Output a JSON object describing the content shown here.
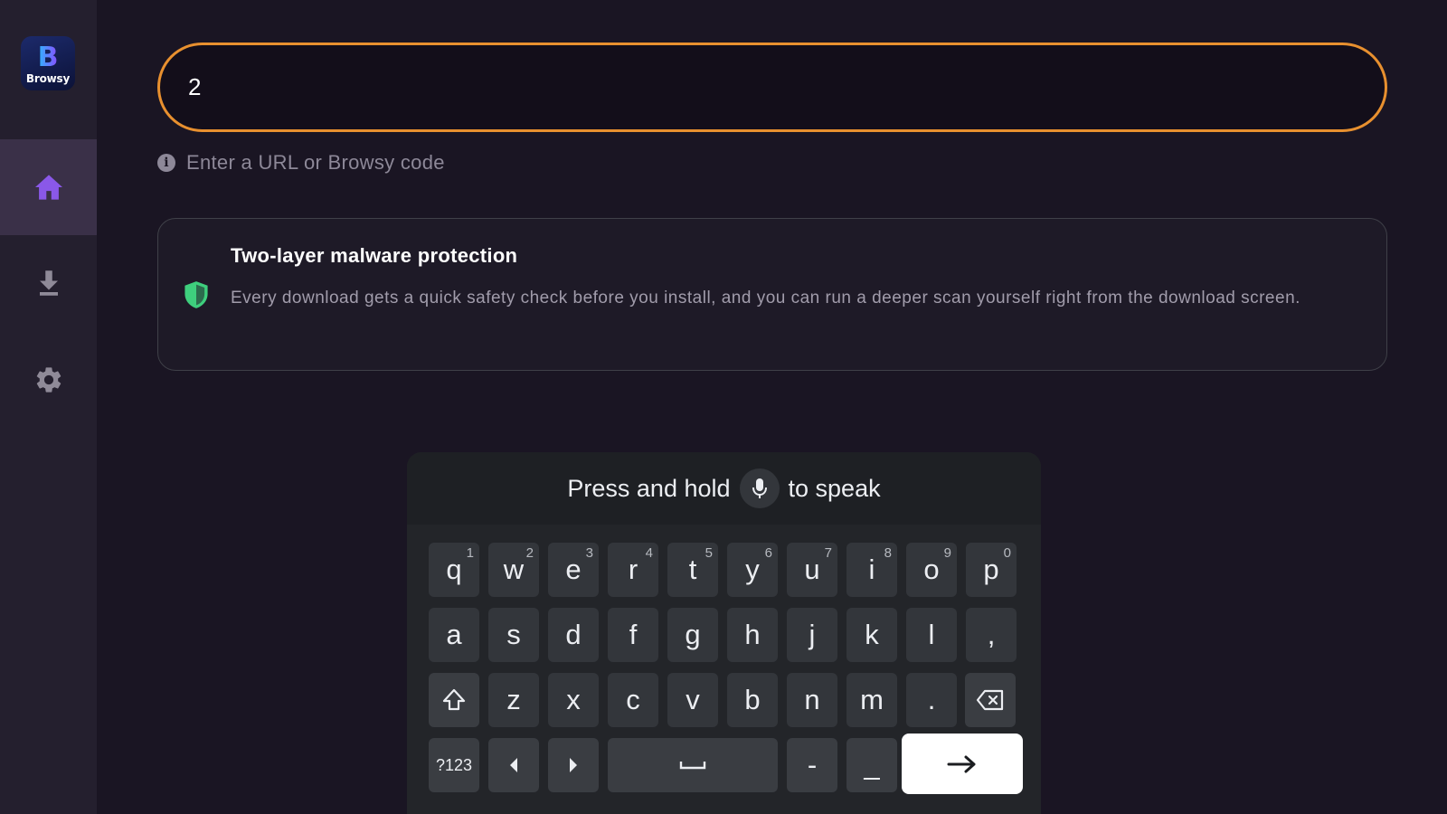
{
  "app": {
    "name": "Browsy"
  },
  "sidebar": {
    "logo_text": "Browsy",
    "logo_letter": "B",
    "items": [
      {
        "name": "home",
        "icon": "home-icon",
        "active": true
      },
      {
        "name": "downloads",
        "icon": "download-icon",
        "active": false
      },
      {
        "name": "settings",
        "icon": "gear-icon",
        "active": false
      }
    ]
  },
  "search": {
    "value": "2",
    "hint": "Enter a URL or Browsy code",
    "accent_color": "#e8902f"
  },
  "card": {
    "title": "Two-layer malware protection",
    "body": "Every download gets a quick safety check before you install, and you can run a deeper scan yourself right from the download screen.",
    "icon": "shield-icon",
    "icon_color": "#3ecf7d"
  },
  "keyboard": {
    "voice_prefix": "Press and hold",
    "voice_suffix": "to speak",
    "row1": [
      {
        "k": "q",
        "s": "1"
      },
      {
        "k": "w",
        "s": "2"
      },
      {
        "k": "e",
        "s": "3"
      },
      {
        "k": "r",
        "s": "4"
      },
      {
        "k": "t",
        "s": "5"
      },
      {
        "k": "y",
        "s": "6"
      },
      {
        "k": "u",
        "s": "7"
      },
      {
        "k": "i",
        "s": "8"
      },
      {
        "k": "o",
        "s": "9"
      },
      {
        "k": "p",
        "s": "0"
      }
    ],
    "row2": [
      "a",
      "s",
      "d",
      "f",
      "g",
      "h",
      "j",
      "k",
      "l",
      ","
    ],
    "row3": [
      "z",
      "x",
      "c",
      "v",
      "b",
      "n",
      "m",
      "."
    ],
    "symbols_label": "?123",
    "dash": "-",
    "underscore": "_"
  }
}
